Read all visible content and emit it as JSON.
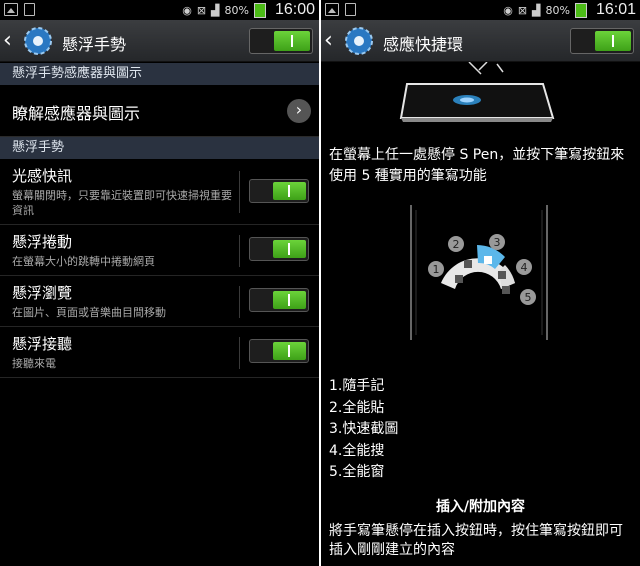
{
  "left_screen": {
    "status_bar": {
      "battery_percent": "80%",
      "time": "16:00"
    },
    "action_bar": {
      "title": "懸浮手勢",
      "master_switch_on": true
    },
    "section_sensors": "懸浮手勢感應器與圖示",
    "learn_item": {
      "label": "瞭解感應器與圖示"
    },
    "section_gestures": "懸浮手勢",
    "gestures": [
      {
        "title": "光感快訊",
        "description": "螢幕關閉時，只要靠近裝置即可快速掃視重要資訊",
        "enabled": true
      },
      {
        "title": "懸浮捲動",
        "description": "在螢幕大小的跳轉中捲動網頁",
        "enabled": true
      },
      {
        "title": "懸浮瀏覽",
        "description": "在圖片、頁面或音樂曲目間移動",
        "enabled": true
      },
      {
        "title": "懸浮接聽",
        "description": "接聽來電",
        "enabled": true
      }
    ]
  },
  "right_screen": {
    "status_bar": {
      "battery_percent": "80%",
      "time": "16:01"
    },
    "action_bar": {
      "title": "感應快捷環",
      "master_switch_on": true
    },
    "instruction": "在螢幕上任一處懸停 S Pen，並按下筆寫按鈕來使用 5 種實用的筆寫功能",
    "menu_numbers": [
      "1",
      "2",
      "3",
      "4",
      "5"
    ],
    "features": [
      "1.隨手記",
      "2.全能貼",
      "3.快速截圖",
      "4.全能搜",
      "5.全能窗"
    ],
    "insert_heading": "插入/附加內容",
    "insert_text": "將手寫筆懸停在插入按鈕時，按住筆寫按鈕即可插入剛剛建立的內容"
  },
  "colors": {
    "switch_on": "#4cbb17",
    "section_header_bg": "#2a3240",
    "action_bar_bg": "#2e3033",
    "hover_highlight": "#2f8ecf"
  }
}
